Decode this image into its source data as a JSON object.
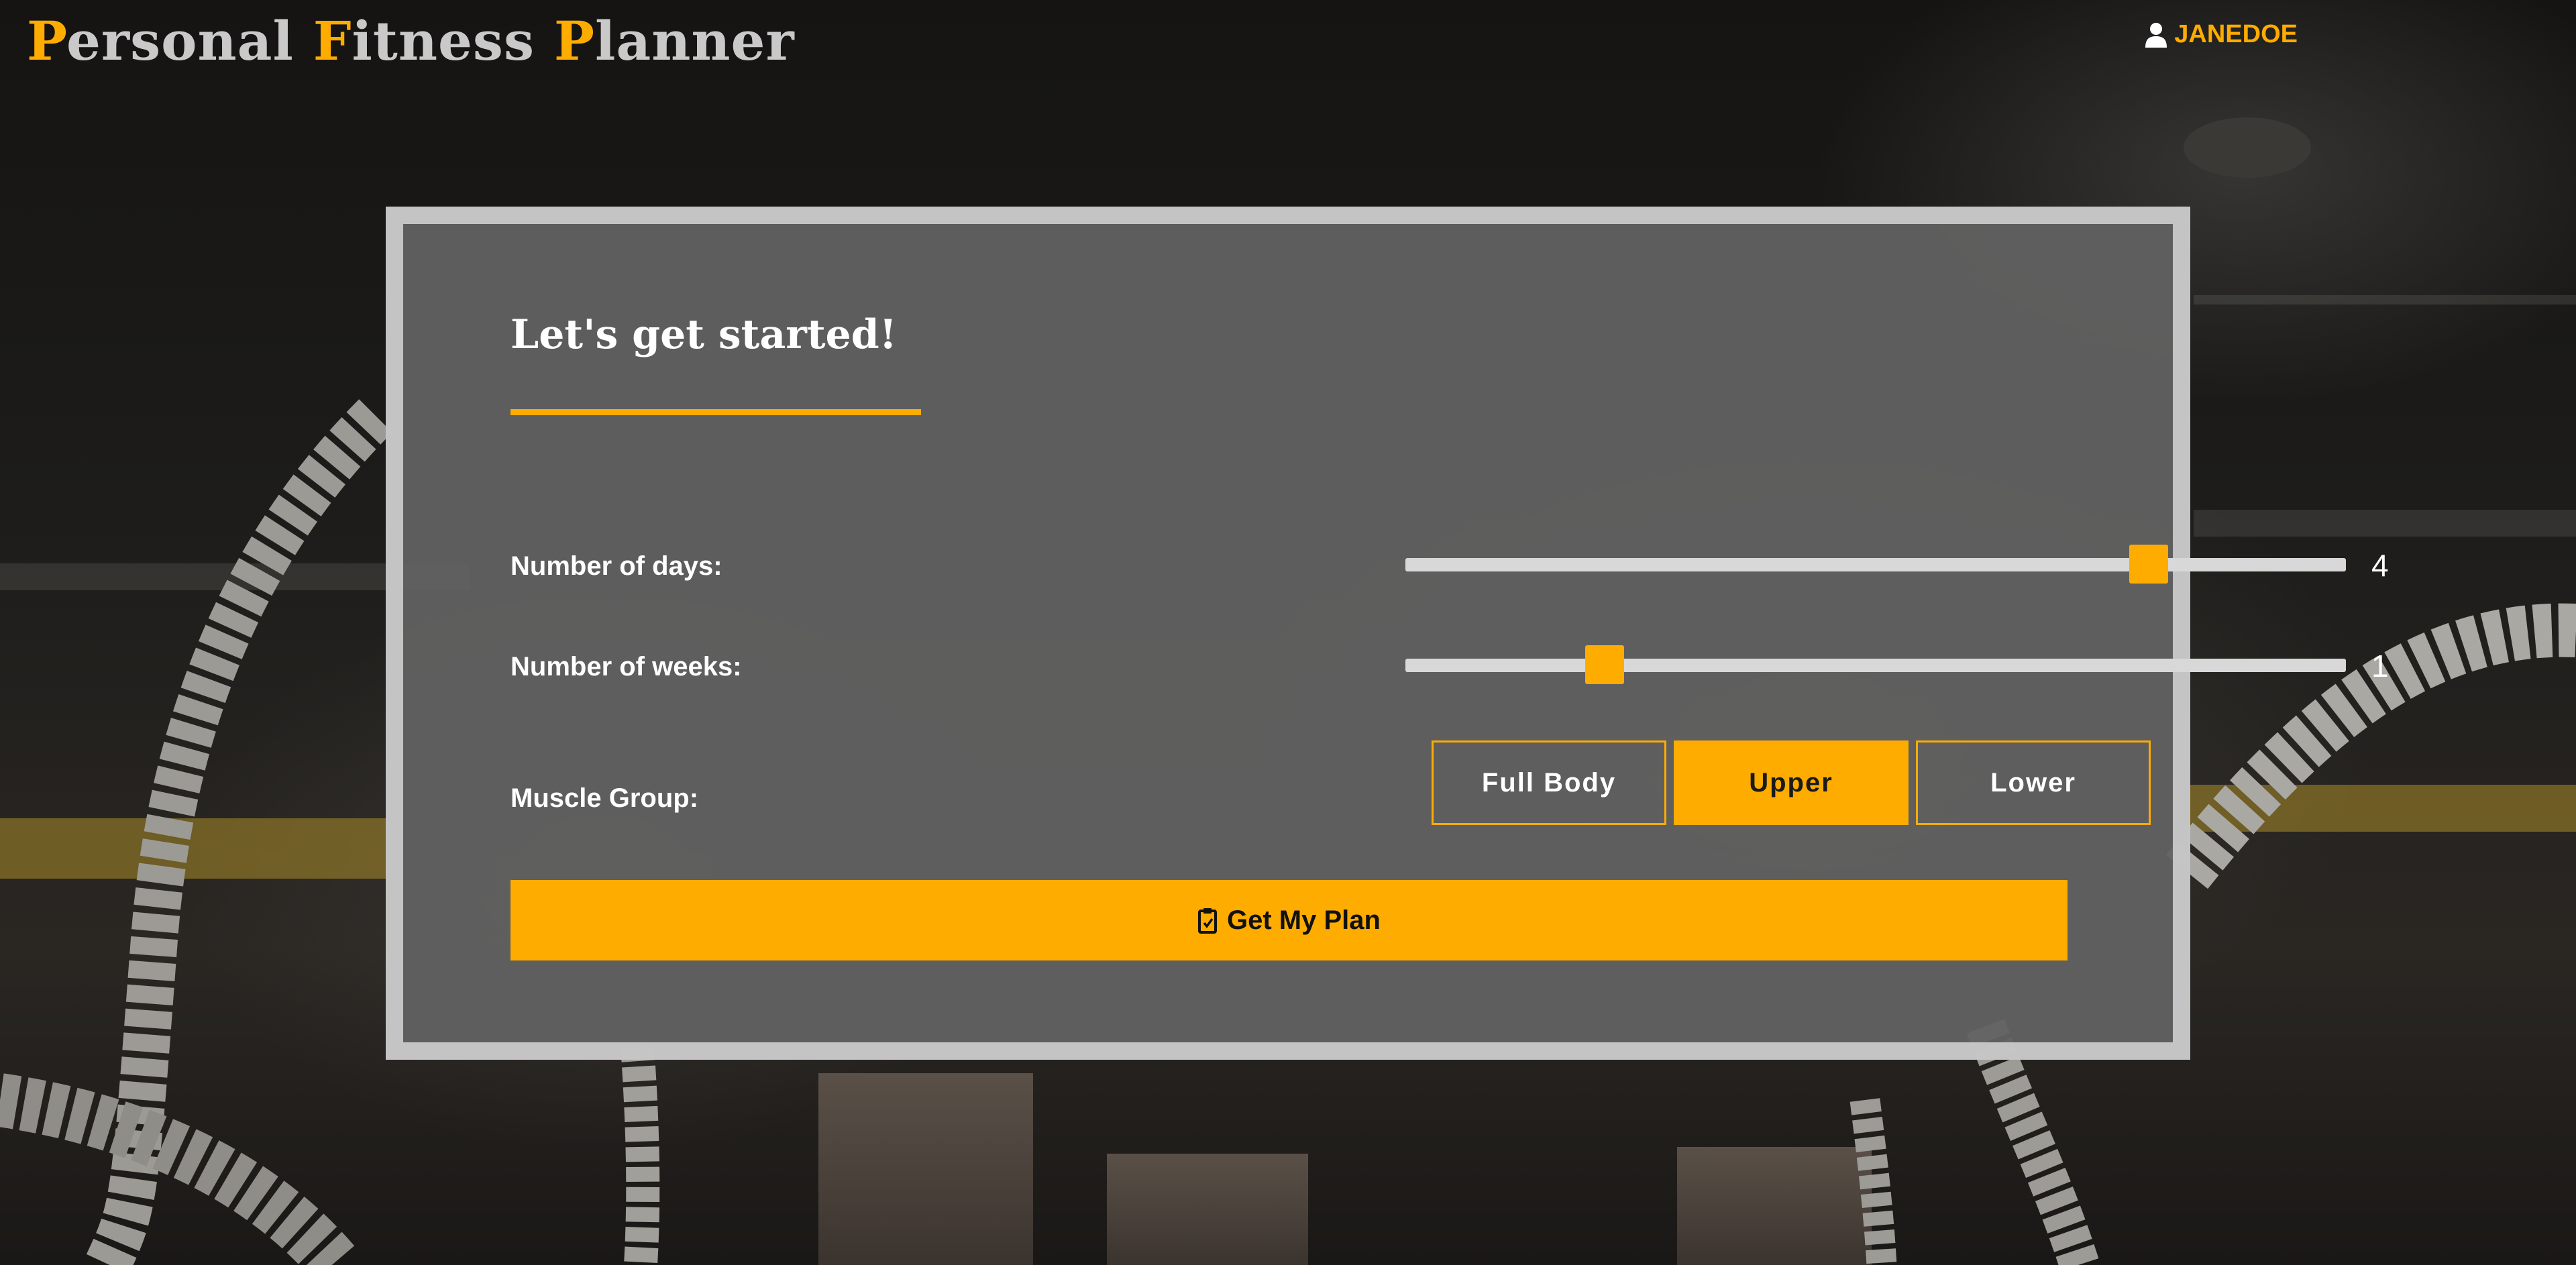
{
  "header": {
    "brand": [
      {
        "initial": "P",
        "rest": "ersonal "
      },
      {
        "initial": "F",
        "rest": "itness "
      },
      {
        "initial": "P",
        "rest": "lanner"
      }
    ],
    "user_icon": "user-icon",
    "username": "JANEDOE"
  },
  "form": {
    "title": "Let's get started!",
    "days": {
      "label": "Number of days:",
      "value": "4",
      "fraction": 0.79
    },
    "weeks": {
      "label": "Number of weeks:",
      "value": "1",
      "fraction": 0.212
    },
    "muscle_group": {
      "label": "Muscle Group:",
      "options": [
        "Full Body",
        "Upper",
        "Lower"
      ],
      "selected": "Upper"
    },
    "submit": {
      "icon": "clipboard-icon",
      "label": "Get My Plan"
    }
  },
  "colors": {
    "accent": "#ffac00",
    "card_bg": "#626262",
    "card_border": "#cdcdcd",
    "text": "#ffffff"
  }
}
